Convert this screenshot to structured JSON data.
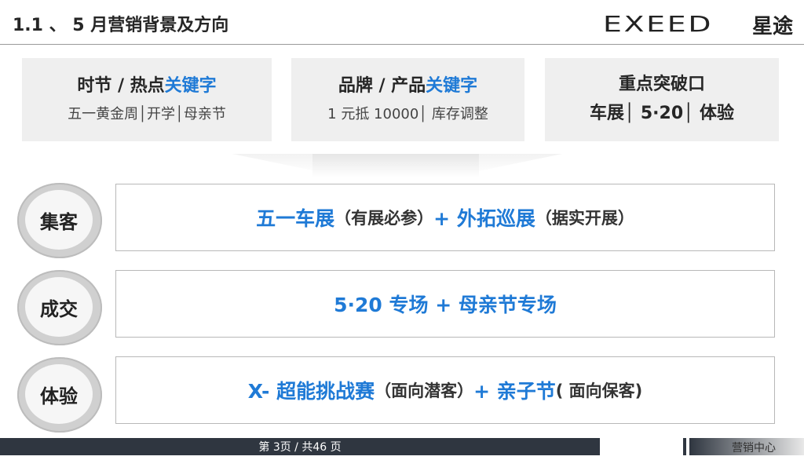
{
  "header": {
    "title": "1.1 、 5 月营销背景及方向",
    "logo_en": "EXEED",
    "logo_cn": "星途"
  },
  "cards": [
    {
      "title_prefix": "时节 / 热点",
      "title_highlight": "关键字",
      "subtitle": "五一黄金周│开学│母亲节"
    },
    {
      "title_prefix": "品牌 / 产品",
      "title_highlight": "关键字",
      "subtitle": "1 元抵 10000│ 库存调整"
    },
    {
      "title": "重点突破口",
      "subtitle": "车展│ 5·20│ 体验"
    }
  ],
  "rows": [
    {
      "label": "集客",
      "part1": "五一车展",
      "part2": "（有展必参）",
      "part3": " + 外拓巡展",
      "part4": "（据实开展）"
    },
    {
      "label": "成交",
      "part1": "5·20 专场 + 母亲节专场"
    },
    {
      "label": "体验",
      "part1": "X- 超能挑战赛",
      "part2": "（面向潜客）",
      "part3": " + 亲子节",
      "part4": " ( 面向保客)"
    }
  ],
  "footer": {
    "page_text": "第 3页 / 共46 页",
    "right_text": "营销中心"
  }
}
